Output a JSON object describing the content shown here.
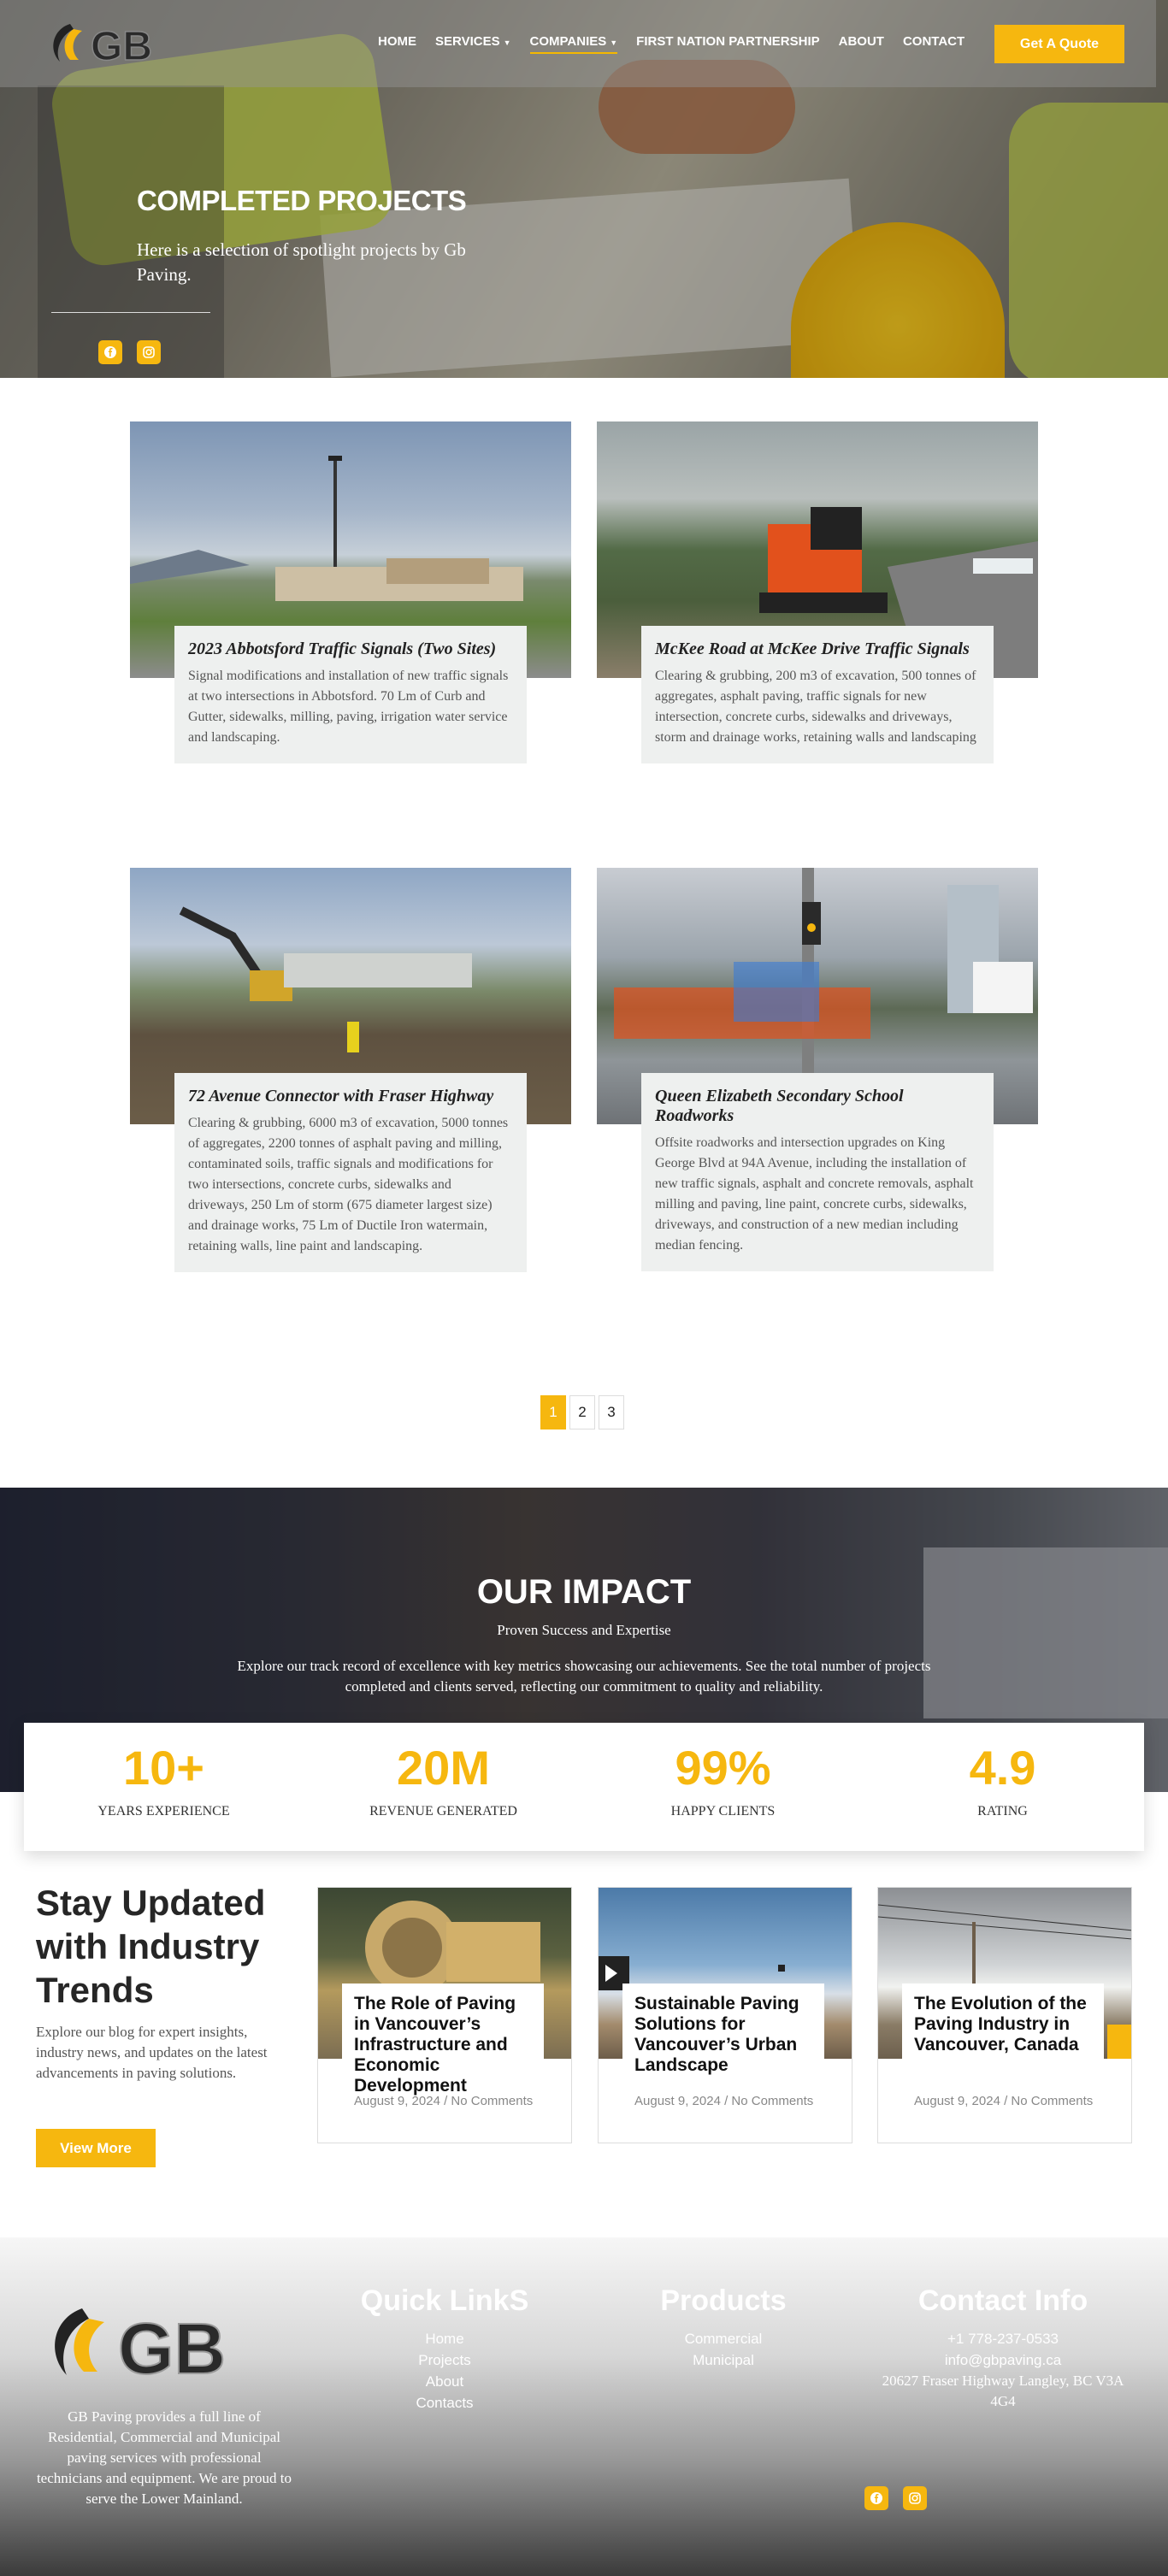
{
  "brand": {
    "logo_text": "GB",
    "accent": "#f6b70f"
  },
  "nav": {
    "items": [
      {
        "label": "HOME"
      },
      {
        "label": "SERVICES"
      },
      {
        "label": "COMPANIES"
      },
      {
        "label": "FIRST NATION PARTNERSHIP"
      },
      {
        "label": "ABOUT"
      },
      {
        "label": "CONTACT"
      }
    ],
    "quote_label": "Get A Quote"
  },
  "hero": {
    "title": "COMPLETED PROJECTS",
    "subtitle": "Here is a selection of spotlight projects by Gb Paving.",
    "social": [
      "facebook-icon",
      "instagram-icon"
    ]
  },
  "projects": [
    {
      "title": "2023 Abbotsford Traffic Signals (Two Sites)",
      "desc": "Signal modifications and installation of new traffic signals at two intersections in Abbotsford. 70 Lm of Curb and Gutter, sidewalks, milling, paving, irrigation water service and landscaping."
    },
    {
      "title": "McKee Road at McKee Drive Traffic Signals",
      "desc": "Clearing & grubbing, 200 m3 of excavation, 500 tonnes of aggregates, asphalt paving, traffic signals for new intersection, concrete curbs, sidewalks and driveways, storm and drainage works, retaining walls and landscaping"
    },
    {
      "title": "72 Avenue Connector with Fraser Highway",
      "desc": "Clearing & grubbing, 6000 m3 of excavation, 5000 tonnes of aggregates, 2200 tonnes of asphalt paving and milling, contaminated soils, traffic signals and modifications for two intersections, concrete curbs, sidewalks and driveways, 250 Lm of storm (675 diameter largest size) and drainage works, 75 Lm of Ductile Iron watermain, retaining walls, line paint and landscaping."
    },
    {
      "title": "Queen Elizabeth Secondary School Roadworks",
      "desc": "Offsite roadworks and intersection upgrades on King George Blvd at 94A Avenue, including the installation of new traffic signals, asphalt and concrete removals, asphalt milling and paving, line paint, concrete curbs, sidewalks, driveways, and construction of a new median including median fencing."
    }
  ],
  "pagination": {
    "pages": [
      "1",
      "2",
      "3"
    ],
    "current": "1"
  },
  "impact": {
    "title": "OUR IMPACT",
    "subtitle": "Proven Success and Expertise",
    "desc": "Explore our track record of excellence with key metrics showcasing our achievements. See the total number of projects completed and clients served, reflecting our commitment to quality and reliability.",
    "stats": [
      {
        "value": "10+",
        "label": "YEARS EXPERIENCE"
      },
      {
        "value": "20M",
        "label": "REVENUE GENERATED"
      },
      {
        "value": "99%",
        "label": "HAPPY CLIENTS"
      },
      {
        "value": "4.9",
        "label": "RATING"
      }
    ]
  },
  "blog": {
    "heading": "Stay Updated with Industry Trends",
    "intro": "Explore our blog for expert insights, industry news, and updates on the latest advancements in paving solutions.",
    "button": "View More",
    "posts": [
      {
        "title": "The Role of Paving in Vancouver’s Infrastructure and Economic Development",
        "meta": "August 9, 2024 / No Comments"
      },
      {
        "title": "Sustainable Paving Solutions for Vancouver’s Urban Landscape",
        "meta": "August 9, 2024 / No Comments"
      },
      {
        "title": "The Evolution of the Paving Industry in Vancouver, Canada",
        "meta": "August 9, 2024 / No Comments"
      }
    ]
  },
  "footer": {
    "about": "GB Paving provides a full line of Residential, Commercial and Municipal paving services with professional technicians and equipment. We are proud to serve the Lower Mainland.",
    "quick_links": {
      "title": "Quick LinkS",
      "items": [
        "Home",
        "Projects",
        "About",
        "Contacts"
      ]
    },
    "products": {
      "title": "Products",
      "items": [
        "Commercial",
        "Municipal"
      ]
    },
    "contact": {
      "title": "Contact Info",
      "phone": "+1 778-237-0533",
      "email": "info@gbpaving.ca",
      "address": "20627 Fraser Highway Langley, BC V3A 4G4"
    }
  }
}
